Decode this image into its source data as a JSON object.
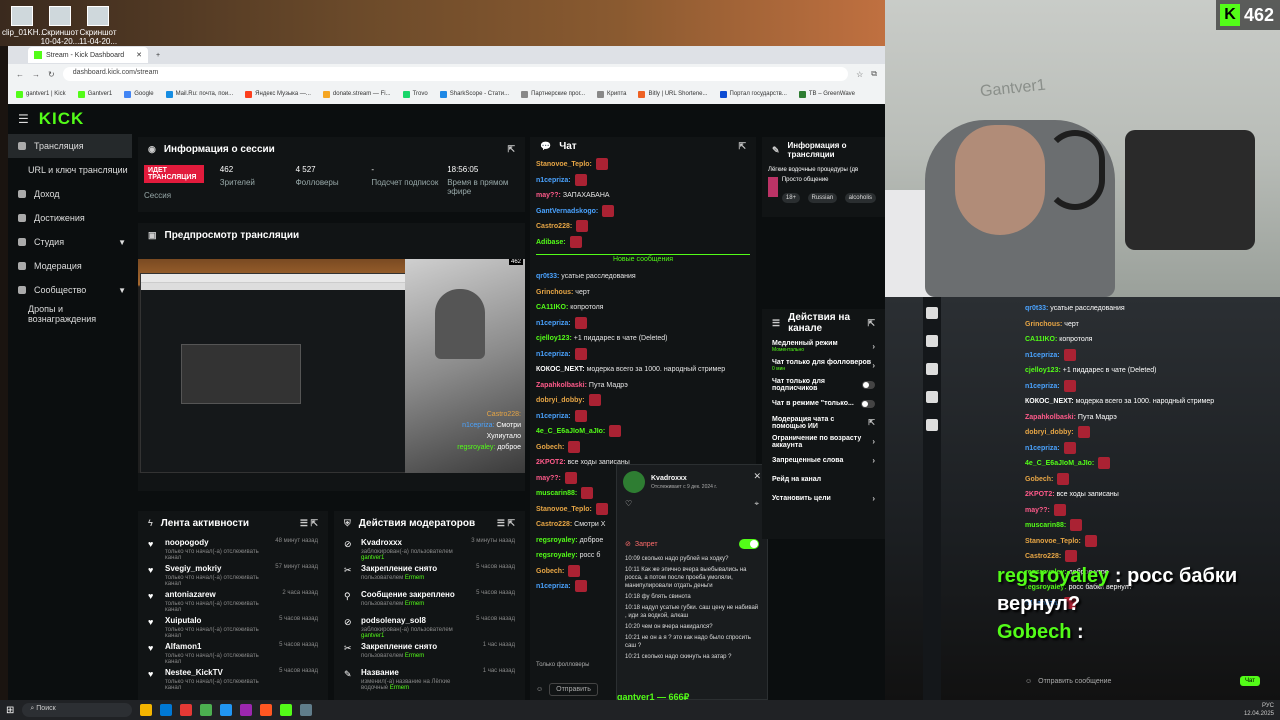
{
  "desktop": {
    "icons": [
      "clip_01KH...",
      "Скриншот 10-04-20...",
      "Скриншот 11-04-20..."
    ]
  },
  "browser": {
    "tab_title": "Stream - Kick Dashboard",
    "url": "dashboard.kick.com/stream",
    "bookmarks": [
      "gantver1 | Kick",
      "Gantver1",
      "Google",
      "Mail.Ru: почта, пои...",
      "Яндекс Музыка —...",
      "donate.stream — Fi...",
      "Trovo",
      "SharkScope - Стати...",
      "Партнерские прог...",
      "Крипта",
      "Bitly | URL Shortene...",
      "Портал государств...",
      "TB – GreenWave"
    ]
  },
  "sidebar": {
    "logo": "KICK",
    "items": [
      "Трансляция",
      "URL и ключ трансляции",
      "Доход",
      "Достижения",
      "Студия",
      "Модерация",
      "Сообщество",
      "Дропы и вознаграждения"
    ]
  },
  "session": {
    "title": "Информация о сессии",
    "live": "ИДЕТ ТРАНСЛЯЦИЯ",
    "session_label": "Сессия",
    "viewers": "462",
    "viewers_label": "Зрителей",
    "followers": "4 527",
    "followers_label": "Фолловеры",
    "subs": "-",
    "subs_label": "Подсчет подписок",
    "time": "18:56:05",
    "time_label": "Время в прямом эфире"
  },
  "preview": {
    "title": "Предпросмотр трансляции",
    "count": "462",
    "chat1_user": "Castro228:",
    "chat2_user": "n1cepriza:",
    "chat2_text": "Смотри",
    "chat3_text": "Хулиутало",
    "chat4_user": "regsroyaley:",
    "chat4_text": "доброе"
  },
  "activity": {
    "title": "Лента активности",
    "rows": [
      {
        "name": "noopogody",
        "sub": "только что начал(-а) отслеживать канал",
        "time": "48 минут назад"
      },
      {
        "name": "Svegiy_mokriy",
        "sub": "только что начал(-а) отслеживать канал",
        "time": "57 минут назад"
      },
      {
        "name": "antoniazarew",
        "sub": "только что начал(-а) отслеживать канал",
        "time": "2 часа назад"
      },
      {
        "name": "Xuiputalo",
        "sub": "только что начал(-а) отслеживать канал",
        "time": "5 часов назад"
      },
      {
        "name": "Alfamon1",
        "sub": "только что начал(-а) отслеживать канал",
        "time": "5 часов назад"
      },
      {
        "name": "Nestee_KickTV",
        "sub": "только что начал(-а) отслеживать канал",
        "time": "5 часов назад"
      }
    ]
  },
  "modactions": {
    "title": "Действия модераторов",
    "rows": [
      {
        "name": "Kvadroxxx",
        "sub": "заблокирован(-а) пользователем",
        "by": "gantver1",
        "time": "3 минуты назад"
      },
      {
        "name": "Закрепление снято",
        "sub": "пользователем",
        "by": "Ermem",
        "time": "5 часов назад"
      },
      {
        "name": "Сообщение закреплено",
        "sub": "пользователем",
        "by": "Ermem",
        "time": "5 часов назад"
      },
      {
        "name": "podsolenay_sol8",
        "sub": "заблокирован(-а) пользователем",
        "by": "gantver1",
        "time": "5 часов назад"
      },
      {
        "name": "Закрепление снято",
        "sub": "пользователем",
        "by": "Ermem",
        "time": "1 час назад"
      },
      {
        "name": "Название",
        "sub": "изменил(-а) название на Лёгкие водочные",
        "by": "Ermem",
        "time": "1 час назад"
      }
    ]
  },
  "chat": {
    "title": "Чат",
    "new_messages": "Новые сообщения",
    "messages_top": [
      {
        "user": "Stanovoe_Teplo:",
        "text": "",
        "color": "#e6a545"
      },
      {
        "user": "n1cepriza:",
        "text": "",
        "color": "#4aa3ff"
      },
      {
        "user": "may??:",
        "text": "ЗАПАХАБАНА",
        "color": "#ff5a8a"
      },
      {
        "user": "GantVernadskogo:",
        "text": "",
        "color": "#4aa3ff"
      },
      {
        "user": "Castro228:",
        "text": "",
        "color": "#e6a545"
      },
      {
        "user": "Adibase:",
        "text": "",
        "color": "#53fc18"
      }
    ],
    "messages": [
      {
        "user": "qr0t33:",
        "text": "усатые расследования",
        "color": "#4aa3ff"
      },
      {
        "user": "Grinchous:",
        "text": "черт",
        "color": "#e6a545"
      },
      {
        "user": "CA11IKO:",
        "text": "копротоля",
        "color": "#53fc18"
      },
      {
        "user": "n1cepriza:",
        "text": "",
        "color": "#4aa3ff"
      },
      {
        "user": "cjelloy123:",
        "text": "+1 пиддарес в чате (Deleted)",
        "color": "#53fc18"
      },
      {
        "user": "n1cepriza:",
        "text": "",
        "color": "#4aa3ff"
      },
      {
        "user": "КОКОС_NEXT:",
        "text": "модерка всего за 1000. народный стример",
        "color": "#ffffff"
      },
      {
        "user": "Zapahkolbaski:",
        "text": "Пута Мадрэ",
        "color": "#ff5a8a"
      },
      {
        "user": "dobryi_dobby:",
        "text": "",
        "color": "#e6a545"
      },
      {
        "user": "n1cepriza:",
        "text": "",
        "color": "#4aa3ff"
      },
      {
        "user": "4e_C_E6aJIoM_aJIo:",
        "text": "",
        "color": "#53fc18"
      },
      {
        "user": "Gobech:",
        "text": "",
        "color": "#e6a545"
      },
      {
        "user": "2KPOT2:",
        "text": "все ходы записаны",
        "color": "#ff5a8a"
      },
      {
        "user": "may??:",
        "text": "",
        "color": "#ff5a8a"
      },
      {
        "user": "muscarin88:",
        "text": "",
        "color": "#53fc18"
      },
      {
        "user": "Stanovoe_Teplo:",
        "text": "",
        "color": "#e6a545"
      },
      {
        "user": "Castro228:",
        "text": "Смотри Х",
        "color": "#e6a545"
      },
      {
        "user": "regsroyaley:",
        "text": "доброе",
        "color": "#53fc18"
      },
      {
        "user": "regsroyaley:",
        "text": "росс б",
        "color": "#53fc18"
      },
      {
        "user": "Gobech:",
        "text": "",
        "color": "#e6a545"
      },
      {
        "user": "n1cepriza:",
        "text": "",
        "color": "#4aa3ff"
      }
    ],
    "followers_only": "Только фолловеры",
    "send": "Отправить"
  },
  "popup": {
    "name": "Kvadroxxx",
    "sub": "Отслеживает с 9 дек. 2024 г.",
    "ban": "Запрет",
    "log": [
      "10:09 сколько надо рублей на ходку?",
      "10:11 Как же эпично вчера выебывались на росса, а потом после проеба умоляли, манипулировали отдать деньги",
      "10:18 фу блять свинота",
      "10:18 надул усатые губки. саш цену не набивай , иди за водкой, алкаш",
      "10:20 чем он вчера накидался?",
      "10:21 не он а я ? это как надо было спросить саш ?",
      "10:21 сколько надо скинуть на затар ?"
    ],
    "footer": "gantver1 — 666₽"
  },
  "stream_info": {
    "title": "Информация о трансляции",
    "stream_title": "Лёгкие водочные процедуры (дв",
    "category": "Просто общение",
    "tags": [
      "18+",
      "Russian",
      "alcoholis"
    ]
  },
  "channel_actions": {
    "title": "Действия на канале",
    "rows": [
      {
        "label": "Медленный режим",
        "sub": "Моментально",
        "control": "chevron"
      },
      {
        "label": "Чат только для фолловеров",
        "sub": "0 мин",
        "control": "chevron"
      },
      {
        "label": "Чат только для подписчиков",
        "sub": "",
        "control": "toggle"
      },
      {
        "label": "Чат в режиме \"только...",
        "sub": "",
        "control": "toggle"
      },
      {
        "label": "Модерация чата с помощью ИИ",
        "sub": "",
        "control": "ext"
      },
      {
        "label": "Ограничение по возрасту аккаунта",
        "sub": "",
        "control": "chevron"
      },
      {
        "label": "Запрещенные слова",
        "sub": "",
        "control": "chevron"
      },
      {
        "label": "Рейд на канал",
        "sub": "",
        "control": ""
      },
      {
        "label": "Установить цели",
        "sub": "",
        "control": "chevron"
      }
    ]
  },
  "webcam": {
    "kick_count": "462",
    "wall_text": "Gantver1"
  },
  "overlay": {
    "messages": [
      {
        "user": "qr0t33:",
        "text": "усатые расследования",
        "color": "#4aa3ff"
      },
      {
        "user": "Grinchous:",
        "text": "черт",
        "color": "#e6a545"
      },
      {
        "user": "CA11IKO:",
        "text": "копротоля",
        "color": "#53fc18"
      },
      {
        "user": "n1cepriza:",
        "text": "",
        "color": "#4aa3ff"
      },
      {
        "user": "cjelloy123:",
        "text": "+1 пиддарес в чате (Deleted)",
        "color": "#53fc18"
      },
      {
        "user": "n1cepriza:",
        "text": "",
        "color": "#4aa3ff"
      },
      {
        "user": "КОКОС_NEXT:",
        "text": "модерка всего за 1000. народный стример",
        "color": "#ffffff"
      },
      {
        "user": "Zapahkolbaski:",
        "text": "Пута Мадрэ",
        "color": "#ff5a8a"
      },
      {
        "user": "dobryi_dobby:",
        "text": "",
        "color": "#e6a545"
      },
      {
        "user": "n1cepriza:",
        "text": "",
        "color": "#4aa3ff"
      },
      {
        "user": "4e_C_E6aJIoM_aJIo:",
        "text": "",
        "color": "#53fc18"
      },
      {
        "user": "Gobech:",
        "text": "",
        "color": "#e6a545"
      },
      {
        "user": "2KPOT2:",
        "text": "все ходы записаны",
        "color": "#ff5a8a"
      },
      {
        "user": "may??:",
        "text": "",
        "color": "#ff5a8a"
      },
      {
        "user": "muscarin88:",
        "text": "",
        "color": "#53fc18"
      },
      {
        "user": "Stanovoe_Teplo:",
        "text": "",
        "color": "#e6a545"
      },
      {
        "user": "Castro228:",
        "text": "",
        "color": "#e6a545"
      },
      {
        "user": "regsroyaley:",
        "text": "доброе утро",
        "color": "#53fc18"
      },
      {
        "user": "regsroyaley:",
        "text": "росс бабки вернул?",
        "color": "#53fc18"
      },
      {
        "user": "n1cepriza:",
        "text": "",
        "color": "#4aa3ff"
      }
    ],
    "big_line1_user": "regsroyaley",
    "big_line1_text": ": росс бабки",
    "big_line2_text": "вернул?",
    "big_line3_user": "Gobech",
    "big_line3_text": ":",
    "input_placeholder": "Отправить сообщение",
    "send": "Чат"
  },
  "taskbar": {
    "search": "Поиск",
    "lang": "РУС",
    "time": "",
    "date": "12.04.2025"
  },
  "colors": {
    "kick_green": "#53fc18",
    "live_red": "#e21b3c",
    "panel_bg": "#111415"
  }
}
